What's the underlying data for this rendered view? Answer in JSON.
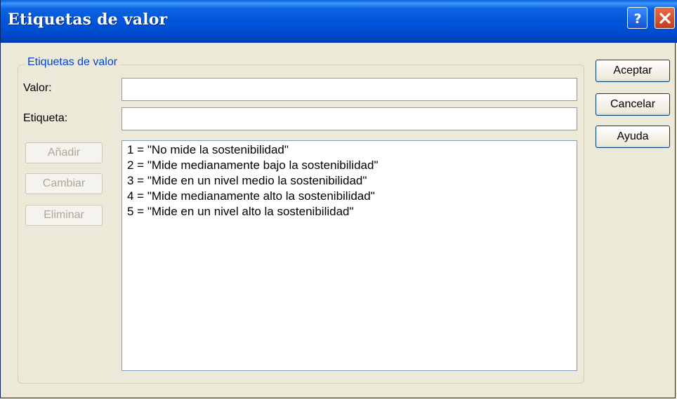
{
  "window": {
    "title": "Etiquetas de valor"
  },
  "group": {
    "legend": "Etiquetas de valor"
  },
  "fields": {
    "valor": {
      "label": "Valor:",
      "value": ""
    },
    "etiqueta": {
      "label": "Etiqueta:",
      "value": ""
    }
  },
  "edit_buttons": {
    "add": "Añadir",
    "change": "Cambiar",
    "remove": "Eliminar"
  },
  "value_labels": [
    "1 = \"No mide la sostenibilidad\"",
    "2 = \"Mide medianamente bajo la sostenibilidad\"",
    "3 = \"Mide en un nivel medio la sostenibilidad\"",
    "4 = \"Mide medianamente alto la sostenibilidad\"",
    "5 = \"Mide en un nivel alto la sostenibilidad\""
  ],
  "dialog_buttons": {
    "accept": "Aceptar",
    "cancel": "Cancelar",
    "help": "Ayuda"
  },
  "colors": {
    "titlebar": "#0053d9",
    "legend_text": "#0046d5",
    "disabled_text": "#aca899",
    "close_button": "#c23d1e"
  },
  "icons": {
    "help": "question-icon",
    "close": "close-x-icon"
  }
}
